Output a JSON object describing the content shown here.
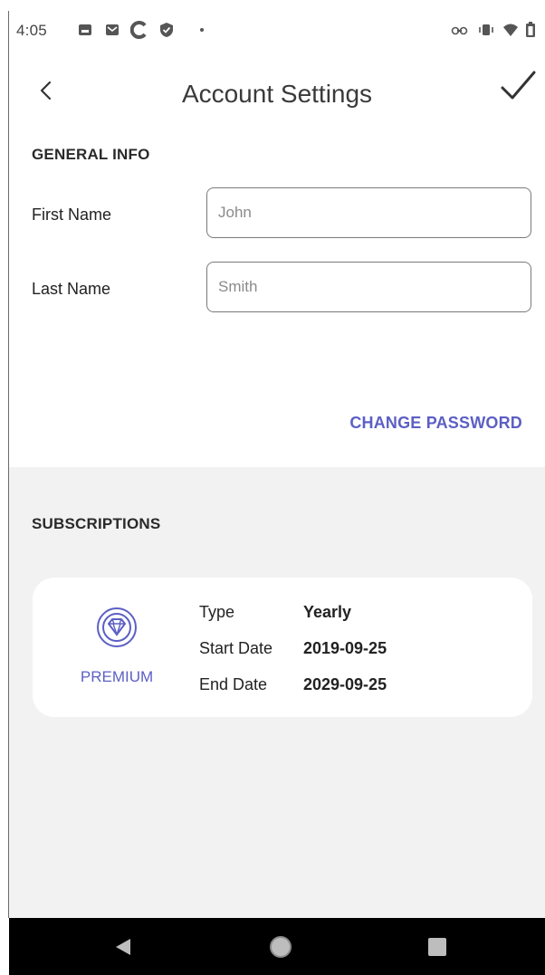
{
  "status_bar": {
    "time": "4:05"
  },
  "app_bar": {
    "title": "Account Settings"
  },
  "general_info": {
    "heading": "GENERAL INFO",
    "first_name": {
      "label": "First Name",
      "placeholder": "John"
    },
    "last_name": {
      "label": "Last Name",
      "placeholder": "Smith"
    },
    "change_password": "CHANGE PASSWORD"
  },
  "subscriptions": {
    "heading": "SUBSCRIPTIONS",
    "plan": {
      "name": "PREMIUM",
      "icon": "diamond-icon"
    },
    "rows": [
      {
        "key": "Type",
        "value": "Yearly"
      },
      {
        "key": "Start Date",
        "value": "2019-09-25"
      },
      {
        "key": "End Date",
        "value": "2029-09-25"
      }
    ]
  },
  "colors": {
    "accent": "#5c5fc4",
    "section_bg": "#f2f2f2",
    "nav_bg": "#000000"
  }
}
